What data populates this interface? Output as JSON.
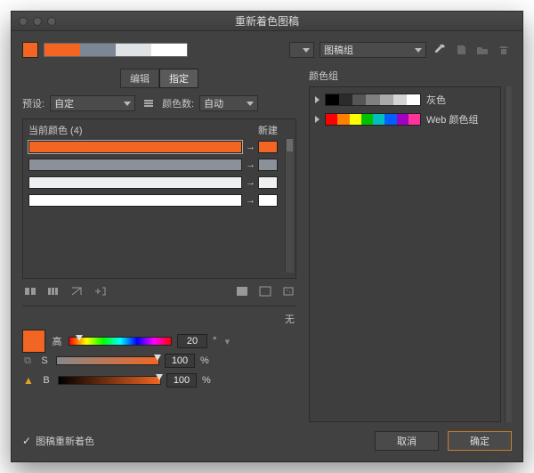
{
  "title": "重新着色图稿",
  "topbar": {
    "swatch_color": "#f26522",
    "strip_colors": [
      "#f26522",
      "#7b8794",
      "#dfe3e6",
      "#ffffff"
    ],
    "group_dd": "图稿组"
  },
  "tabs": {
    "edit": "编辑",
    "assign": "指定"
  },
  "preset": {
    "label": "预设:",
    "value": "自定"
  },
  "colorcount": {
    "label": "颜色数:",
    "value": "自动"
  },
  "panel": {
    "current_label": "当前颜色 (4)",
    "new_label": "新建"
  },
  "rows": [
    {
      "bar": "#f26522",
      "target": "#f26522",
      "selected": true
    },
    {
      "bar": "#8b9199",
      "target": "#8b9199",
      "selected": false
    },
    {
      "bar": "#eef0f1",
      "target": "#eef0f1",
      "selected": false
    },
    {
      "bar": "#ffffff",
      "target": "#ffffff",
      "selected": false
    }
  ],
  "none": "无",
  "hsb": {
    "swatch": "#f26522",
    "h_label": "高",
    "h_value": "20",
    "h_unit": "°",
    "s_label": "S",
    "s_value": "100",
    "s_unit": "%",
    "b_label": "B",
    "b_value": "100",
    "b_unit": "%"
  },
  "rightpanel": {
    "header": "颜色组",
    "groups": [
      {
        "name": "灰色",
        "colors": [
          "#000000",
          "#2b2b2b",
          "#555555",
          "#808080",
          "#aaaaaa",
          "#d4d4d4",
          "#ffffff"
        ]
      },
      {
        "name": "Web 颜色组",
        "colors": [
          "#ff0000",
          "#ff8000",
          "#ffff00",
          "#00c000",
          "#00c0c0",
          "#0060ff",
          "#a000c0",
          "#ff3399"
        ]
      }
    ]
  },
  "footer": {
    "recolor_artwork": "图稿重新着色",
    "cancel": "取消",
    "ok": "确定"
  }
}
